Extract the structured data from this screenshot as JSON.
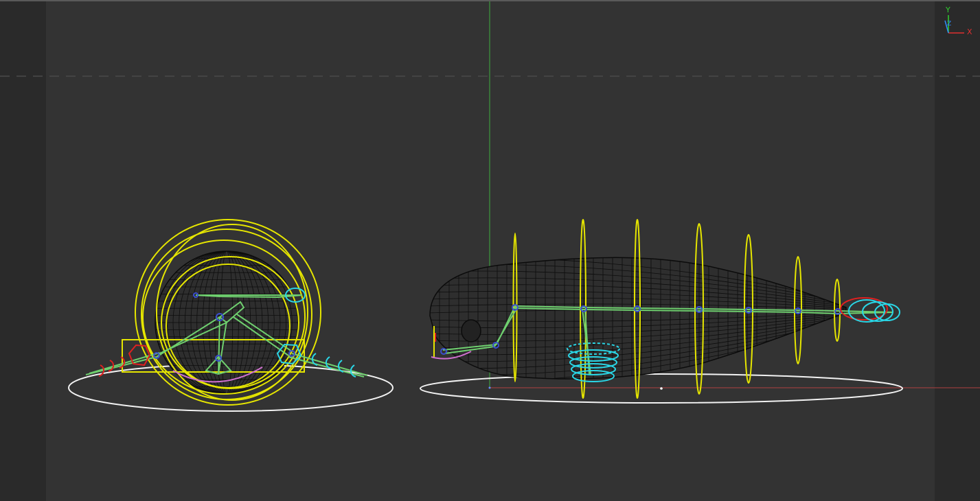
{
  "viewport": {
    "background": "#333333",
    "strip_color": "#2a2a2a"
  },
  "axis_gizmo": {
    "y_label": "Y",
    "z_label": "Z",
    "x_label": "X",
    "y_color": "#2fd02f",
    "z_color": "#2f8fff",
    "x_color": "#e03030"
  },
  "colors": {
    "mesh_wire": "#0b0b0b",
    "ring_control": "#e6e600",
    "bone": "#6fd06f",
    "joint": "#3a4fd0",
    "cyan_control": "#2ad6e6",
    "red_control": "#e02020",
    "pink_control": "#d070d0",
    "ground_circle": "#f2f2f2",
    "world_y_axis": "#3fae3f",
    "world_x_axis": "#b04040"
  }
}
